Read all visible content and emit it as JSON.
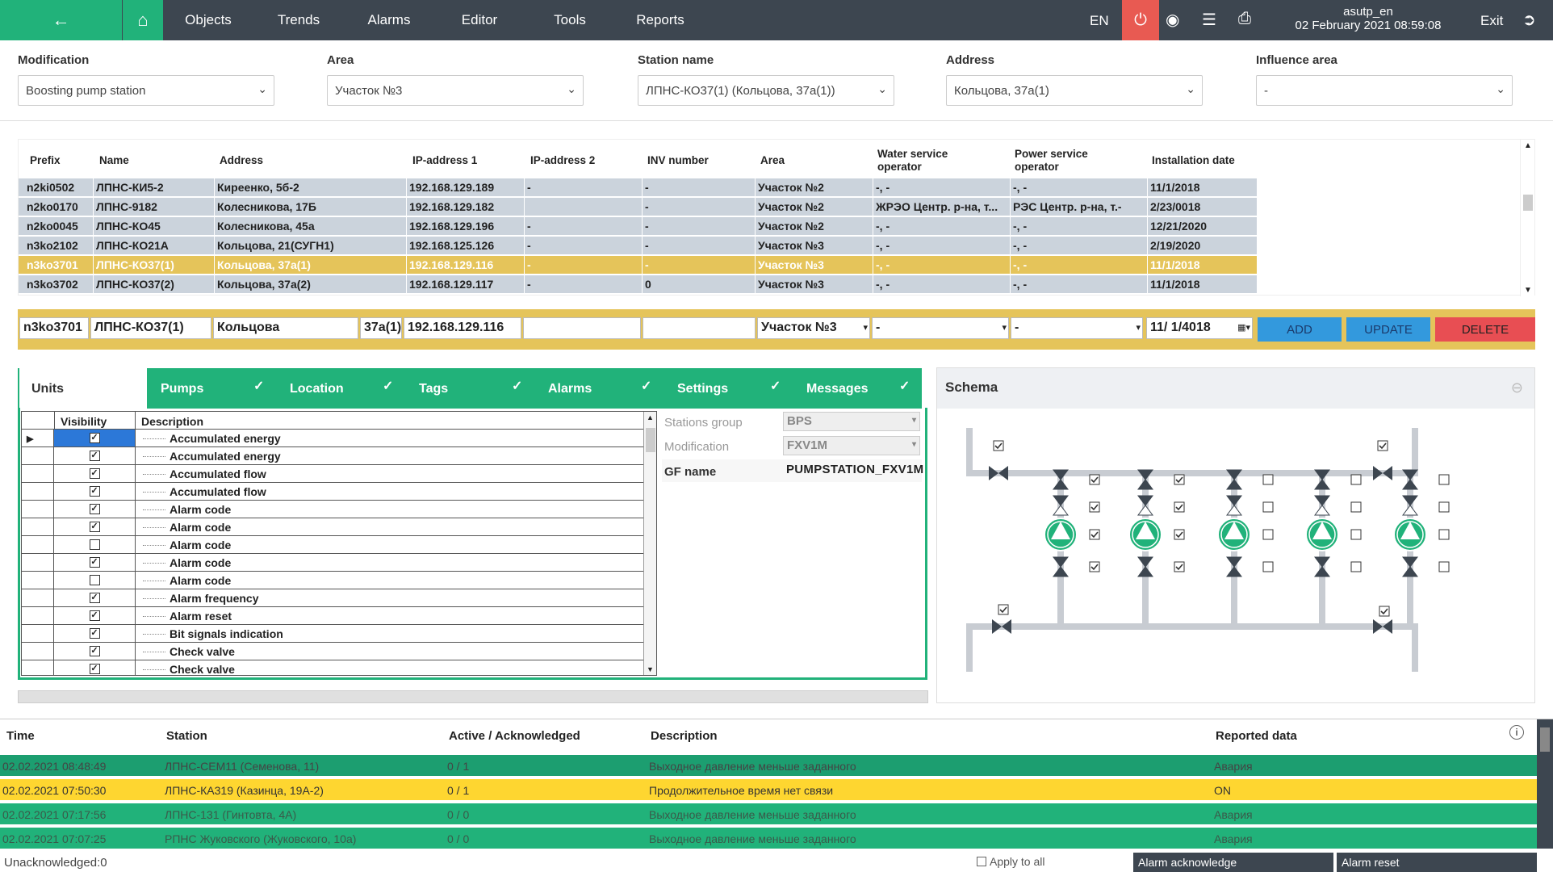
{
  "nav": {
    "back_icon": "arrow-left-icon",
    "home_icon": "home-icon",
    "menu": [
      "Objects",
      "Trends",
      "Alarms",
      "Editor",
      "Tools",
      "Reports"
    ],
    "lang": "EN",
    "user": "asutp_en",
    "datetime": "02 February 2021 08:59:08",
    "exit": "Exit",
    "alarm_color": "#e85a52"
  },
  "filters": {
    "modification": {
      "label": "Modification",
      "value": "Boosting pump station"
    },
    "area": {
      "label": "Area",
      "value": "Участок №3"
    },
    "station": {
      "label": "Station name",
      "value": "ЛПНС-КО37(1) (Кольцова, 37а(1))"
    },
    "address": {
      "label": "Address",
      "value": "Кольцова, 37а(1)"
    },
    "influence": {
      "label": "Influence area",
      "value": "-"
    }
  },
  "stations": {
    "headers": [
      "Prefix",
      "Name",
      "Address",
      "IP-address 1",
      "IP-address 2",
      "INV number",
      "Area",
      "Water service operator",
      "Power service operator",
      "Installation date"
    ],
    "rows": [
      [
        "n2ki0502",
        "ЛПНС-КИ5-2",
        "Киреенко, 5б-2",
        "192.168.129.189",
        "-",
        "-",
        "Участок №2",
        "-, -",
        "-, -",
        "11/1/2018"
      ],
      [
        "n2ko0170",
        "ЛПНС-9182",
        "Колесникова, 17Б",
        "192.168.129.182",
        "",
        "-",
        "Участок №2",
        "ЖРЭО Центр. р-на, т...",
        "РЭС Центр. р-на, т.-",
        "2/23/0018"
      ],
      [
        "n2ko0045",
        "ЛПНС-КО45",
        "Колесникова, 45а",
        "192.168.129.196",
        "-",
        "-",
        "Участок №2",
        "-, -",
        "-, -",
        "12/21/2020"
      ],
      [
        "n3ko2102",
        "ЛПНС-КО21А",
        "Кольцова, 21(СУГН1)",
        "192.168.125.126",
        "-",
        "-",
        "Участок №3",
        "-, -",
        "-, -",
        "2/19/2020"
      ],
      [
        "n3ko3701",
        "ЛПНС-КО37(1)",
        "Кольцова, 37а(1)",
        "192.168.129.116",
        "-",
        "-",
        "Участок №3",
        "-, -",
        "-, -",
        "11/1/2018"
      ],
      [
        "n3ko3702",
        "ЛПНС-КО37(2)",
        "Кольцова, 37а(2)",
        "192.168.129.117",
        "-",
        "0",
        "Участок №3",
        "-, -",
        "-, -",
        "11/1/2018"
      ]
    ],
    "selected_index": 4
  },
  "edit": {
    "prefix": "n3ko3701",
    "name": "ЛПНС-КО37(1)",
    "street": "Кольцова",
    "house": "37а(1)",
    "ip1": "192.168.129.116",
    "ip2": "",
    "inv": "",
    "area": "Участок №3",
    "water": "-",
    "power": "-",
    "date": "11/  1/4018",
    "add": "ADD",
    "update": "UPDATE",
    "delete": "DELETE"
  },
  "tabs": [
    {
      "label": "Units",
      "check": ""
    },
    {
      "label": "Pumps",
      "check": "✓"
    },
    {
      "label": "Location",
      "check": "✓"
    },
    {
      "label": "Tags",
      "check": "✓"
    },
    {
      "label": "Alarms",
      "check": "✓"
    },
    {
      "label": "Settings",
      "check": "✓"
    },
    {
      "label": "Messages",
      "check": "✓"
    }
  ],
  "units": {
    "headers": {
      "visibility": "Visibility",
      "description": "Description"
    },
    "rows": [
      {
        "desc": "Accumulated energy",
        "visible": true
      },
      {
        "desc": "Accumulated energy",
        "visible": true
      },
      {
        "desc": "Accumulated flow",
        "visible": true
      },
      {
        "desc": "Accumulated flow",
        "visible": true
      },
      {
        "desc": "Alarm code",
        "visible": true
      },
      {
        "desc": "Alarm code",
        "visible": true
      },
      {
        "desc": "Alarm code",
        "visible": false
      },
      {
        "desc": "Alarm code",
        "visible": true
      },
      {
        "desc": "Alarm code",
        "visible": false
      },
      {
        "desc": "Alarm frequency",
        "visible": true
      },
      {
        "desc": "Alarm reset",
        "visible": true
      },
      {
        "desc": "Bit signals indication",
        "visible": true
      },
      {
        "desc": "Check valve",
        "visible": true
      },
      {
        "desc": "Check valve",
        "visible": true
      }
    ]
  },
  "props": {
    "group": {
      "label": "Stations group",
      "value": "BPS"
    },
    "modification": {
      "label": "Modification",
      "value": "FXV1M"
    },
    "gf": {
      "label": "GF name",
      "value": "PUMPSTATION_FXV1M"
    }
  },
  "schema": {
    "title": "Schema",
    "pump_color": "#21b27a",
    "top_checks": [
      true,
      true
    ],
    "bottom_checks": [
      true,
      true
    ],
    "columns": [
      {
        "c1": true,
        "c2": true,
        "c3": true,
        "c4": true
      },
      {
        "c1": true,
        "c2": true,
        "c3": true,
        "c4": true
      },
      {
        "c1": false,
        "c2": false,
        "c3": false,
        "c4": false
      },
      {
        "c1": false,
        "c2": false,
        "c3": false,
        "c4": false
      },
      {
        "c1": false,
        "c2": false,
        "c3": false,
        "c4": false
      }
    ]
  },
  "alarms": {
    "headers": [
      "Time",
      "Station",
      "Active / Acknowledged",
      "Description",
      "Reported data"
    ],
    "rows": [
      {
        "time": "02.02.2021 08:48:49",
        "station": "ЛПНС-СЕМ11 (Семенова, 11)",
        "ack": "0 / 1",
        "desc": "Выходное давление меньше заданного",
        "data": "Авария",
        "style": "dark"
      },
      {
        "time": "02.02.2021 07:50:30",
        "station": "ЛПНС-КА319 (Казинца, 19А-2)",
        "ack": "0 / 1",
        "desc": "Продолжительное время нет связи",
        "data": "ON",
        "style": "yellow"
      },
      {
        "time": "02.02.2021 07:17:56",
        "station": "ЛПНС-131 (Гинтовта, 4А)",
        "ack": "0 / 0",
        "desc": "Выходное давление меньше заданного",
        "data": "Авария",
        "style": "green"
      },
      {
        "time": "02.02.2021 07:07:25",
        "station": "РПНС Жуковского (Жуковского, 10а)",
        "ack": "0 / 0",
        "desc": "Выходное давление меньше заданного",
        "data": "Авария",
        "style": "green"
      }
    ],
    "unack": "Unacknowledged:0",
    "apply_all": "Apply to all",
    "ack_btn": "Alarm acknowledge",
    "reset_btn": "Alarm reset"
  }
}
